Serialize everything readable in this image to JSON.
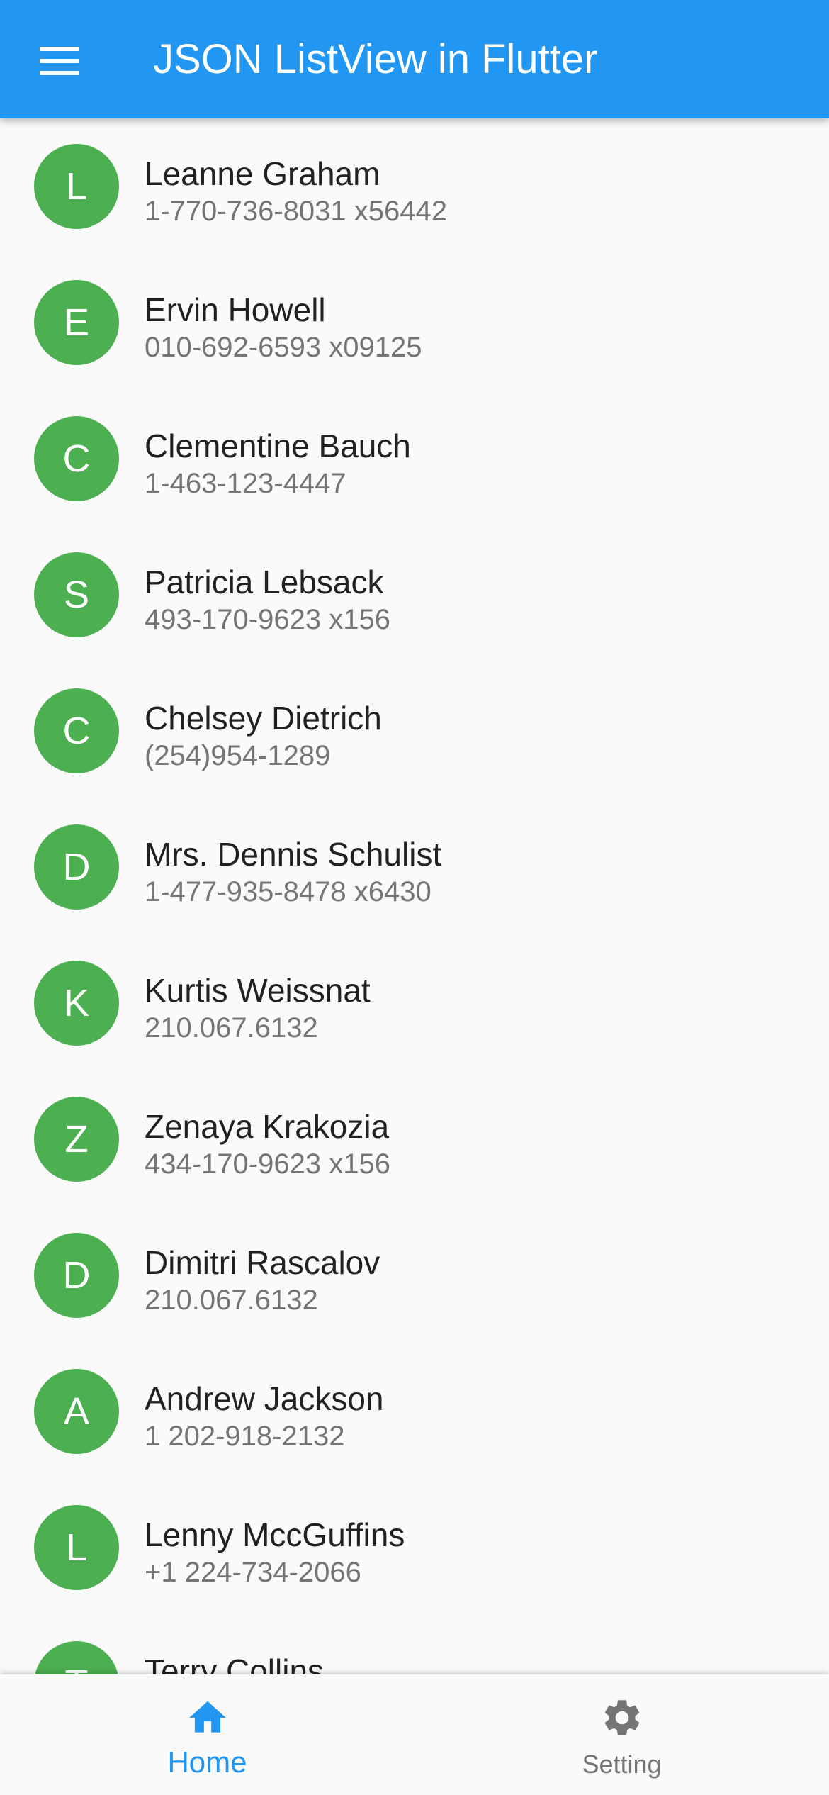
{
  "app_bar": {
    "title": "JSON ListView in Flutter",
    "menu_icon": "menu-icon",
    "background_color": "#2196f3"
  },
  "contacts": [
    {
      "initial": "L",
      "name": "Leanne Graham",
      "phone": "1-770-736-8031 x56442"
    },
    {
      "initial": "E",
      "name": "Ervin Howell",
      "phone": "010-692-6593 x09125"
    },
    {
      "initial": "C",
      "name": "Clementine Bauch",
      "phone": "1-463-123-4447"
    },
    {
      "initial": "S",
      "name": "Patricia Lebsack",
      "phone": "493-170-9623 x156"
    },
    {
      "initial": "C",
      "name": "Chelsey Dietrich",
      "phone": "(254)954-1289"
    },
    {
      "initial": "D",
      "name": "Mrs. Dennis Schulist",
      "phone": "1-477-935-8478 x6430"
    },
    {
      "initial": "K",
      "name": "Kurtis Weissnat",
      "phone": "210.067.6132"
    },
    {
      "initial": "Z",
      "name": "Zenaya Krakozia",
      "phone": "434-170-9623 x156"
    },
    {
      "initial": "D",
      "name": "Dimitri Rascalov",
      "phone": "210.067.6132"
    },
    {
      "initial": "A",
      "name": "Andrew Jackson",
      "phone": "1 202-918-2132"
    },
    {
      "initial": "L",
      "name": "Lenny MccGuffins",
      "phone": "+1 224-734-2066"
    },
    {
      "initial": "T",
      "name": "Terry Collins",
      "phone": ""
    }
  ],
  "avatar_color": "#4caf50",
  "bottom_nav": {
    "items": [
      {
        "label": "Home",
        "icon": "home-icon",
        "active": true
      },
      {
        "label": "Setting",
        "icon": "gear-icon",
        "active": false
      }
    ],
    "active_color": "#2196f3",
    "inactive_color": "#757575"
  }
}
